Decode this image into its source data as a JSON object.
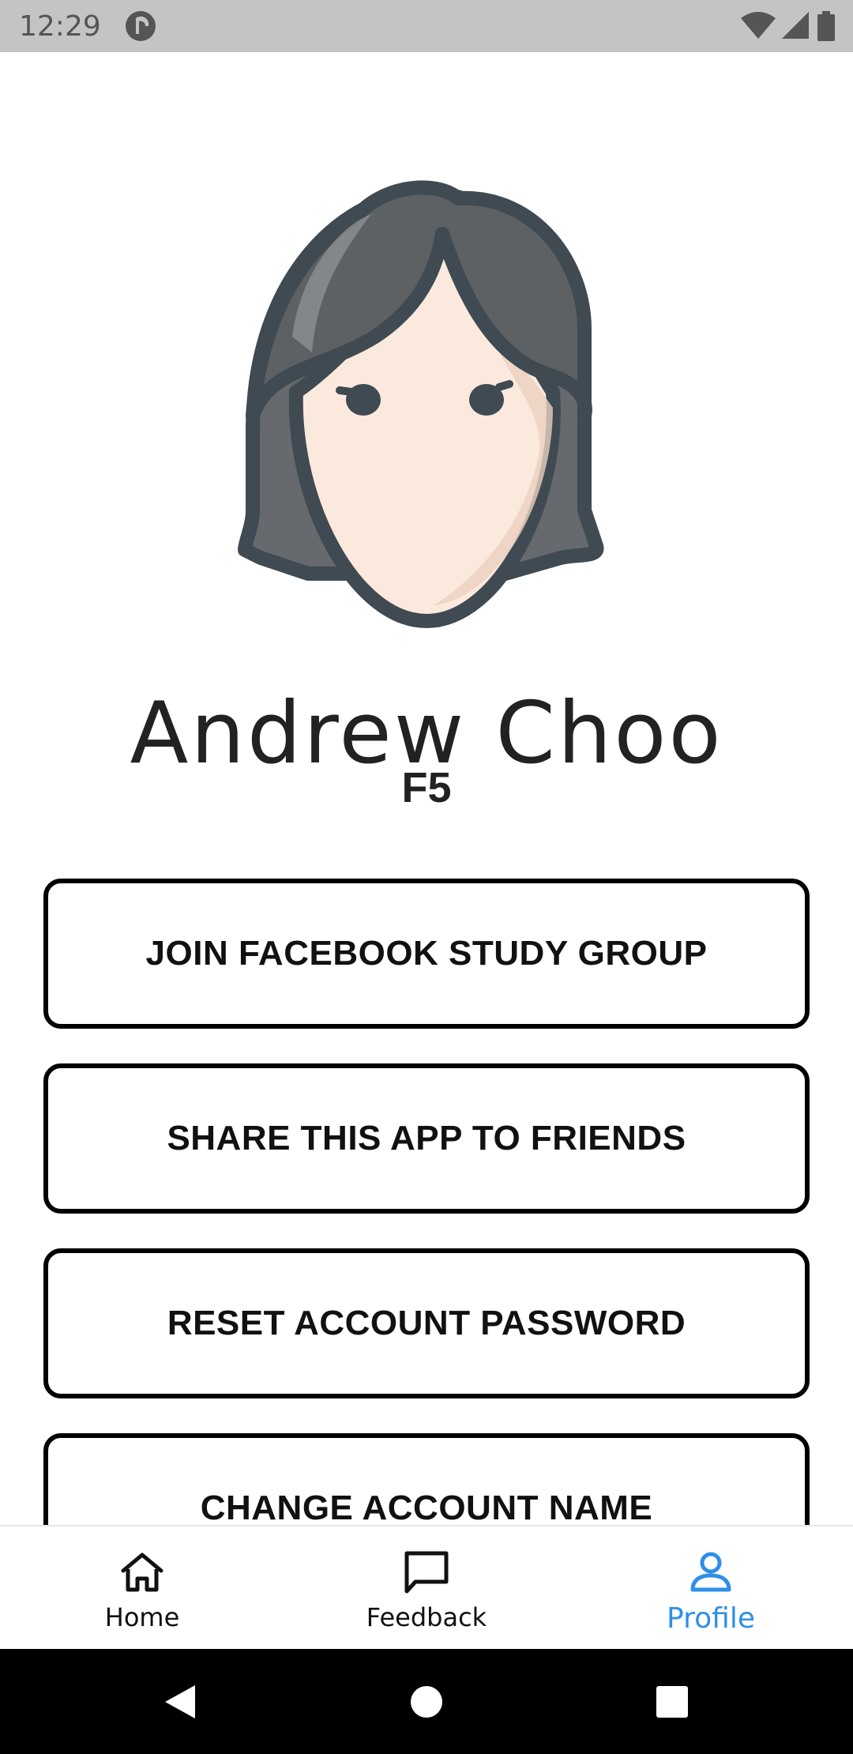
{
  "status_bar": {
    "time": "12:29",
    "app_icon": "pocket-casts-icon",
    "icons": [
      "wifi-icon",
      "signal-icon",
      "battery-icon"
    ]
  },
  "profile": {
    "avatar_icon": "female-avatar-icon",
    "name": "Andrew Choo",
    "class": "F5"
  },
  "actions": [
    {
      "label": "JOIN FACEBOOK STUDY GROUP"
    },
    {
      "label": "SHARE THIS APP TO FRIENDS"
    },
    {
      "label": "RESET ACCOUNT PASSWORD"
    },
    {
      "label": "CHANGE ACCOUNT NAME"
    }
  ],
  "bottom_nav": {
    "items": [
      {
        "label": "Home",
        "icon": "home-icon"
      },
      {
        "label": "Feedback",
        "icon": "feedback-icon"
      },
      {
        "label": "Profile",
        "icon": "profile-icon",
        "active": true
      }
    ],
    "active_color": "#2f8fe8"
  },
  "system_nav": {
    "icons": [
      "back-icon",
      "home-circle-icon",
      "recents-icon"
    ]
  }
}
